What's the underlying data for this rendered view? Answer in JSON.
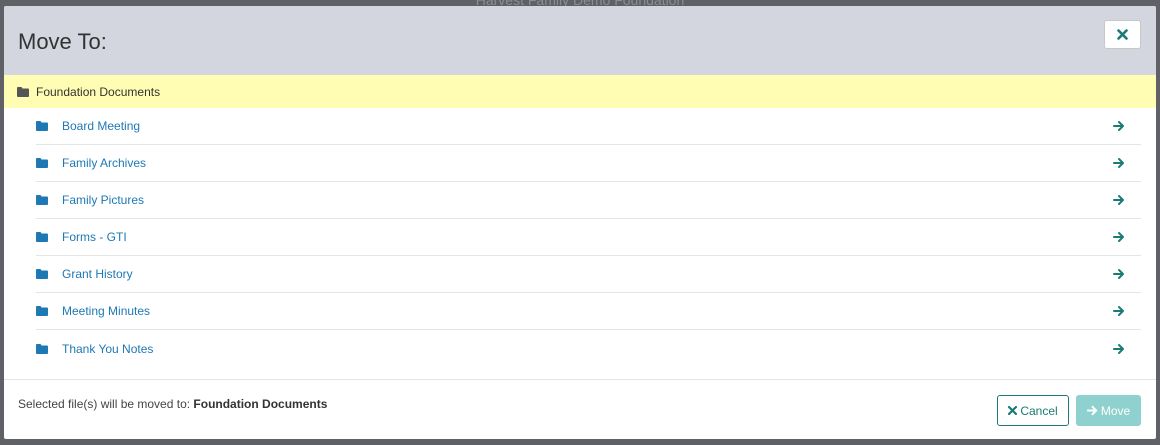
{
  "backdrop": {
    "title": "Harvest Family Demo Foundation"
  },
  "modal": {
    "title": "Move To:",
    "current_folder": "Foundation Documents",
    "folders": [
      {
        "name": "Board Meeting"
      },
      {
        "name": "Family Archives"
      },
      {
        "name": "Family Pictures"
      },
      {
        "name": "Forms - GTI"
      },
      {
        "name": "Grant History"
      },
      {
        "name": "Meeting Minutes"
      },
      {
        "name": "Thank You Notes"
      }
    ],
    "footer": {
      "prefix": "Selected file(s) will be moved to:",
      "destination": "Foundation Documents",
      "cancel_label": "Cancel",
      "move_label": "Move"
    }
  },
  "colors": {
    "header_bg": "#d3d6de",
    "highlight_bg": "#fffdb3",
    "link": "#1e78b4",
    "accent": "#1b7a77",
    "move_disabled": "#8ed1ce"
  },
  "icons": {
    "close": "close-icon",
    "folder": "folder-icon",
    "arrow": "arrow-right-icon",
    "cancel": "times-icon",
    "move": "arrow-right-icon"
  }
}
